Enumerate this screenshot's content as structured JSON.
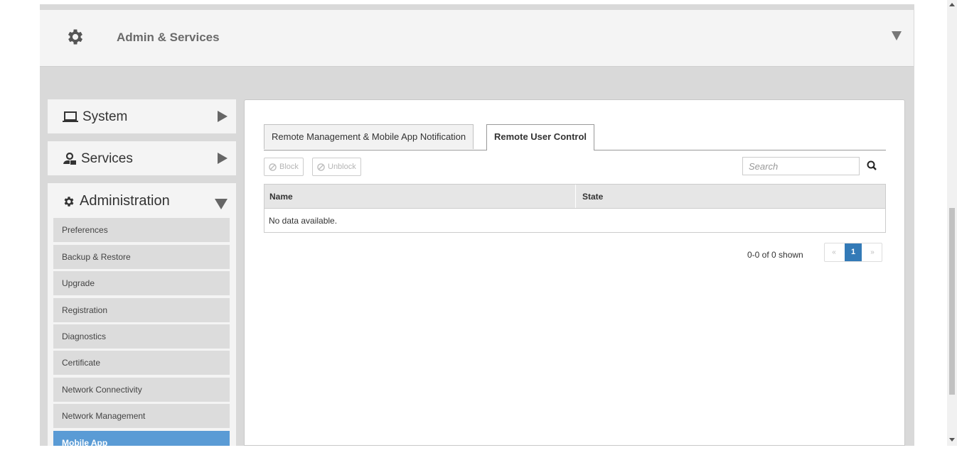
{
  "header": {
    "title": "Admin & Services",
    "icon": "gear-icon"
  },
  "sidebar": {
    "system": {
      "label": "System",
      "icon": "laptop-icon"
    },
    "services": {
      "label": "Services",
      "icon": "services-icon"
    },
    "administration": {
      "label": "Administration",
      "icon": "gear-icon",
      "items": [
        {
          "label": "Preferences"
        },
        {
          "label": "Backup & Restore"
        },
        {
          "label": "Upgrade"
        },
        {
          "label": "Registration"
        },
        {
          "label": "Diagnostics"
        },
        {
          "label": "Certificate"
        },
        {
          "label": "Network Connectivity"
        },
        {
          "label": "Network Management"
        },
        {
          "label": "Mobile App",
          "active": true
        }
      ]
    }
  },
  "main": {
    "tabs": [
      {
        "label": "Remote Management & Mobile App Notification",
        "active": false
      },
      {
        "label": "Remote User Control",
        "active": true
      }
    ],
    "toolbar": {
      "block_label": "Block",
      "unblock_label": "Unblock"
    },
    "search": {
      "placeholder": "Search"
    },
    "table": {
      "columns": [
        "Name",
        "State"
      ],
      "empty_text": "No data available."
    },
    "pagination": {
      "summary": "0-0 of 0 shown",
      "prev": "«",
      "current": "1",
      "next": "»"
    }
  },
  "colors": {
    "accent": "#5a9bd5",
    "pager_active": "#337ab7"
  }
}
